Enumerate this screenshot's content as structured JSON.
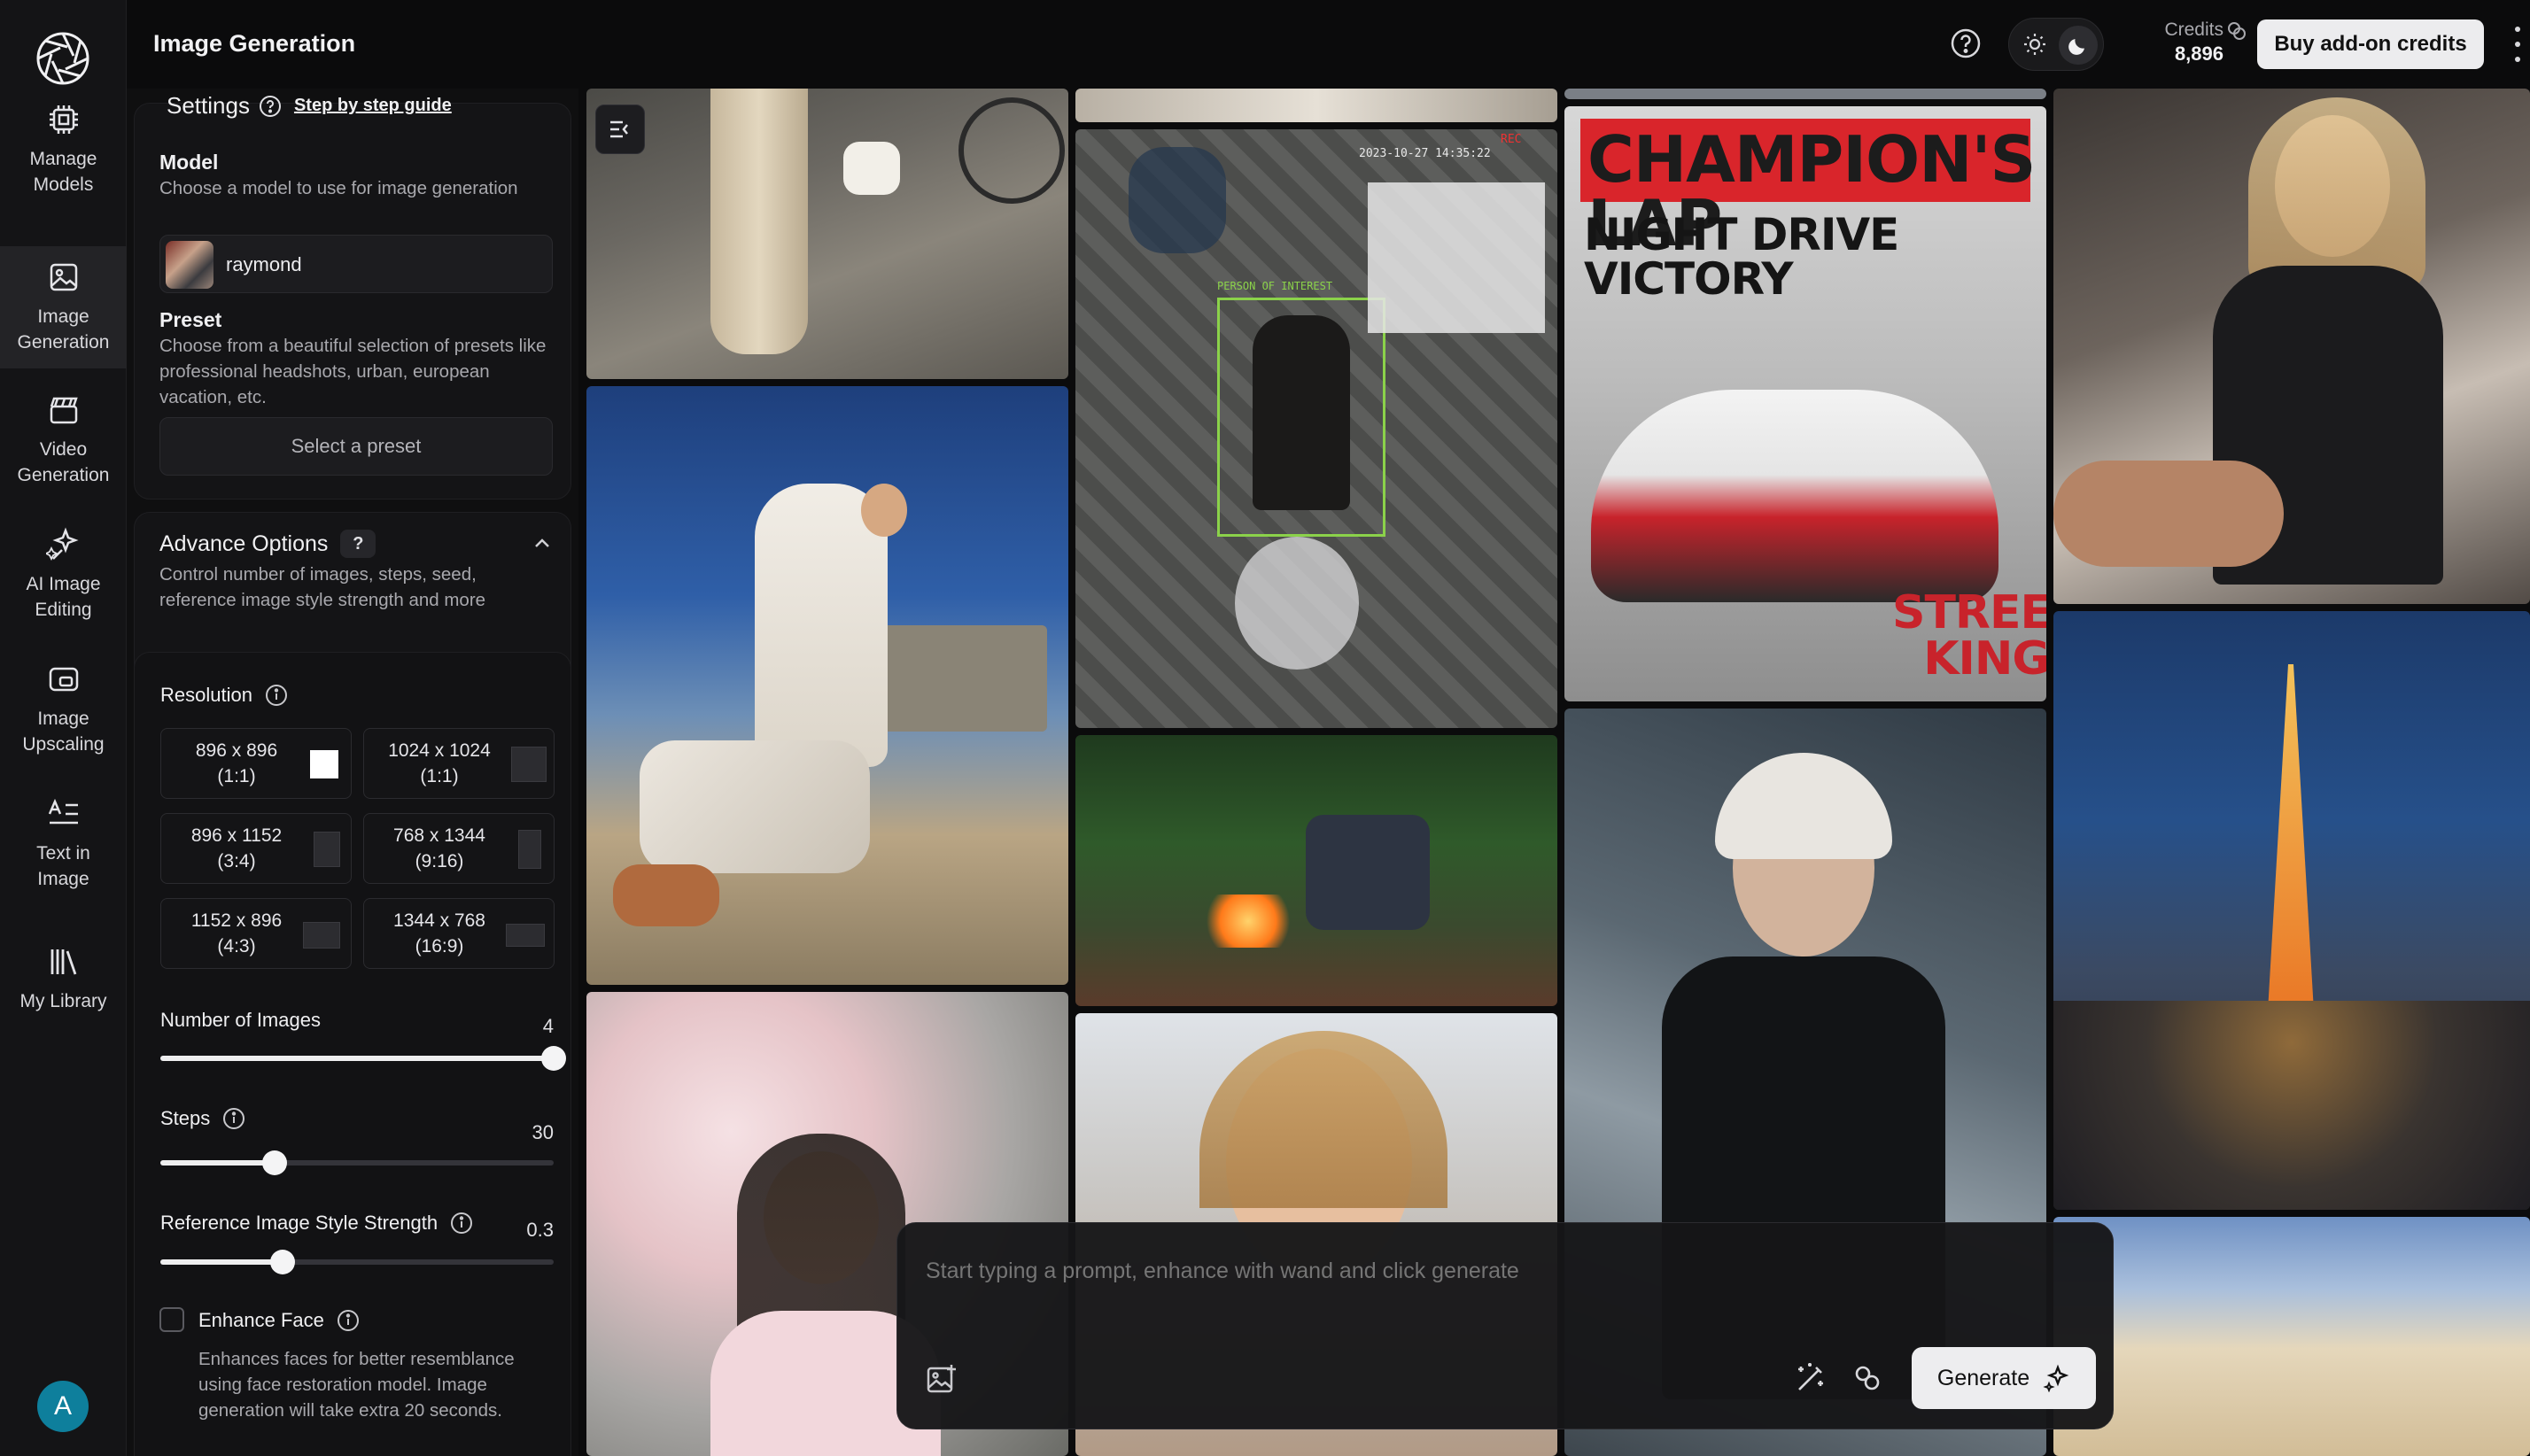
{
  "header": {
    "title": "Image Generation",
    "credits_label": "Credits",
    "credits_value": "8,896",
    "buy_button": "Buy add-on credits"
  },
  "nav": {
    "items": [
      {
        "label": "Manage\nModels",
        "icon": "chip-icon"
      },
      {
        "label": "Image\nGeneration",
        "icon": "image-icon",
        "active": true
      },
      {
        "label": "Video\nGeneration",
        "icon": "clapperboard-icon"
      },
      {
        "label": "AI Image\nEditing",
        "icon": "sparkle-edit-icon"
      },
      {
        "label": "Image\nUpscaling",
        "icon": "upscale-icon"
      },
      {
        "label": "Text in\nImage",
        "icon": "text-icon"
      },
      {
        "label": "My Library",
        "icon": "library-icon"
      }
    ],
    "avatar_initial": "A"
  },
  "settings": {
    "title": "Settings",
    "guide_link": "Step by step guide",
    "model": {
      "title": "Model",
      "description": "Choose a model to use for image generation",
      "selected": "raymond"
    },
    "preset": {
      "title": "Preset",
      "description": "Choose from a beautiful selection of presets like professional headshots, urban, european vacation, etc.",
      "button": "Select a preset"
    },
    "advanced": {
      "title": "Advance Options",
      "help": "?",
      "description": "Control number of images, steps, seed, reference image style strength and more"
    },
    "resolution": {
      "title": "Resolution",
      "options": [
        {
          "label": "896 x 896\n(1:1)",
          "selected": true
        },
        {
          "label": "1024 x 1024\n(1:1)",
          "selected": false
        },
        {
          "label": "896 x 1152\n(3:4)",
          "selected": false
        },
        {
          "label": "768 x 1344\n(9:16)",
          "selected": false
        },
        {
          "label": "1152 x 896\n(4:3)",
          "selected": false
        },
        {
          "label": "1344 x 768\n(16:9)",
          "selected": false
        }
      ]
    },
    "num_images": {
      "title": "Number of Images",
      "value": "4",
      "fraction": 1.0
    },
    "steps": {
      "title": "Steps",
      "value": "30",
      "fraction": 0.29
    },
    "ref_strength": {
      "title": "Reference Image Style Strength",
      "value": "0.3",
      "fraction": 0.31
    },
    "enhance_face": {
      "title": "Enhance Face",
      "checked": false,
      "description": "Enhances faces for better resemblance using face restoration model. Image generation will take extra 20 seconds."
    }
  },
  "gallery": {
    "tiles": [
      {
        "name": "street-walk-photo"
      },
      {
        "name": "bench-fashion-photo"
      },
      {
        "name": "cherry-blossom-photo"
      },
      {
        "name": "building-strip-photo"
      },
      {
        "name": "cctv-surveillance-photo",
        "overlay_label": "PERSON OF INTEREST",
        "timestamp": "2023-10-27 14:35:22",
        "rec": "REC"
      },
      {
        "name": "campfire-blocks-photo"
      },
      {
        "name": "sunset-portrait-photo"
      },
      {
        "name": "magazine-cover-photo",
        "headline": "CHAMPION'S LAP",
        "subhead": "NIGHT DRIVE\nVICTORY",
        "corner": "STREET\nKINGS"
      },
      {
        "name": "sunglasses-portrait-photo"
      },
      {
        "name": "follow-me-photo"
      },
      {
        "name": "tokyo-tower-photo"
      },
      {
        "name": "desert-photo"
      }
    ]
  },
  "prompt": {
    "placeholder": "Start typing a prompt, enhance with wand and click generate",
    "generate_button": "Generate"
  }
}
